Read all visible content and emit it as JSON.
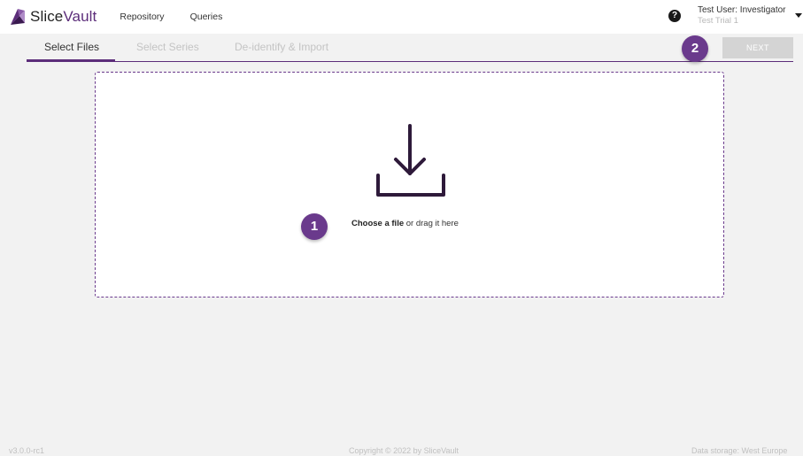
{
  "brand": {
    "name_prefix": "Slice",
    "name_suffix": "Vault",
    "accent_color": "#5c2d7a"
  },
  "nav": {
    "links": [
      {
        "label": "Repository"
      },
      {
        "label": "Queries"
      }
    ]
  },
  "user": {
    "name": "Test User: Investigator",
    "trial": "Test Trial 1"
  },
  "tabs": [
    {
      "label": "Select Files",
      "state": "active"
    },
    {
      "label": "Select Series",
      "state": "disabled"
    },
    {
      "label": "De-identify & Import",
      "state": "disabled"
    }
  ],
  "next_button": {
    "label": "NEXT",
    "enabled": false
  },
  "badges": {
    "first": "1",
    "second": "2"
  },
  "dropzone": {
    "choose_label": "Choose a file",
    "suffix": " or drag it here",
    "icon": "download-icon"
  },
  "footer": {
    "version": "v3.0.0-rc1",
    "copyright": "Copyright © 2022 by SliceVault",
    "storage": "Data storage: West Europe"
  }
}
